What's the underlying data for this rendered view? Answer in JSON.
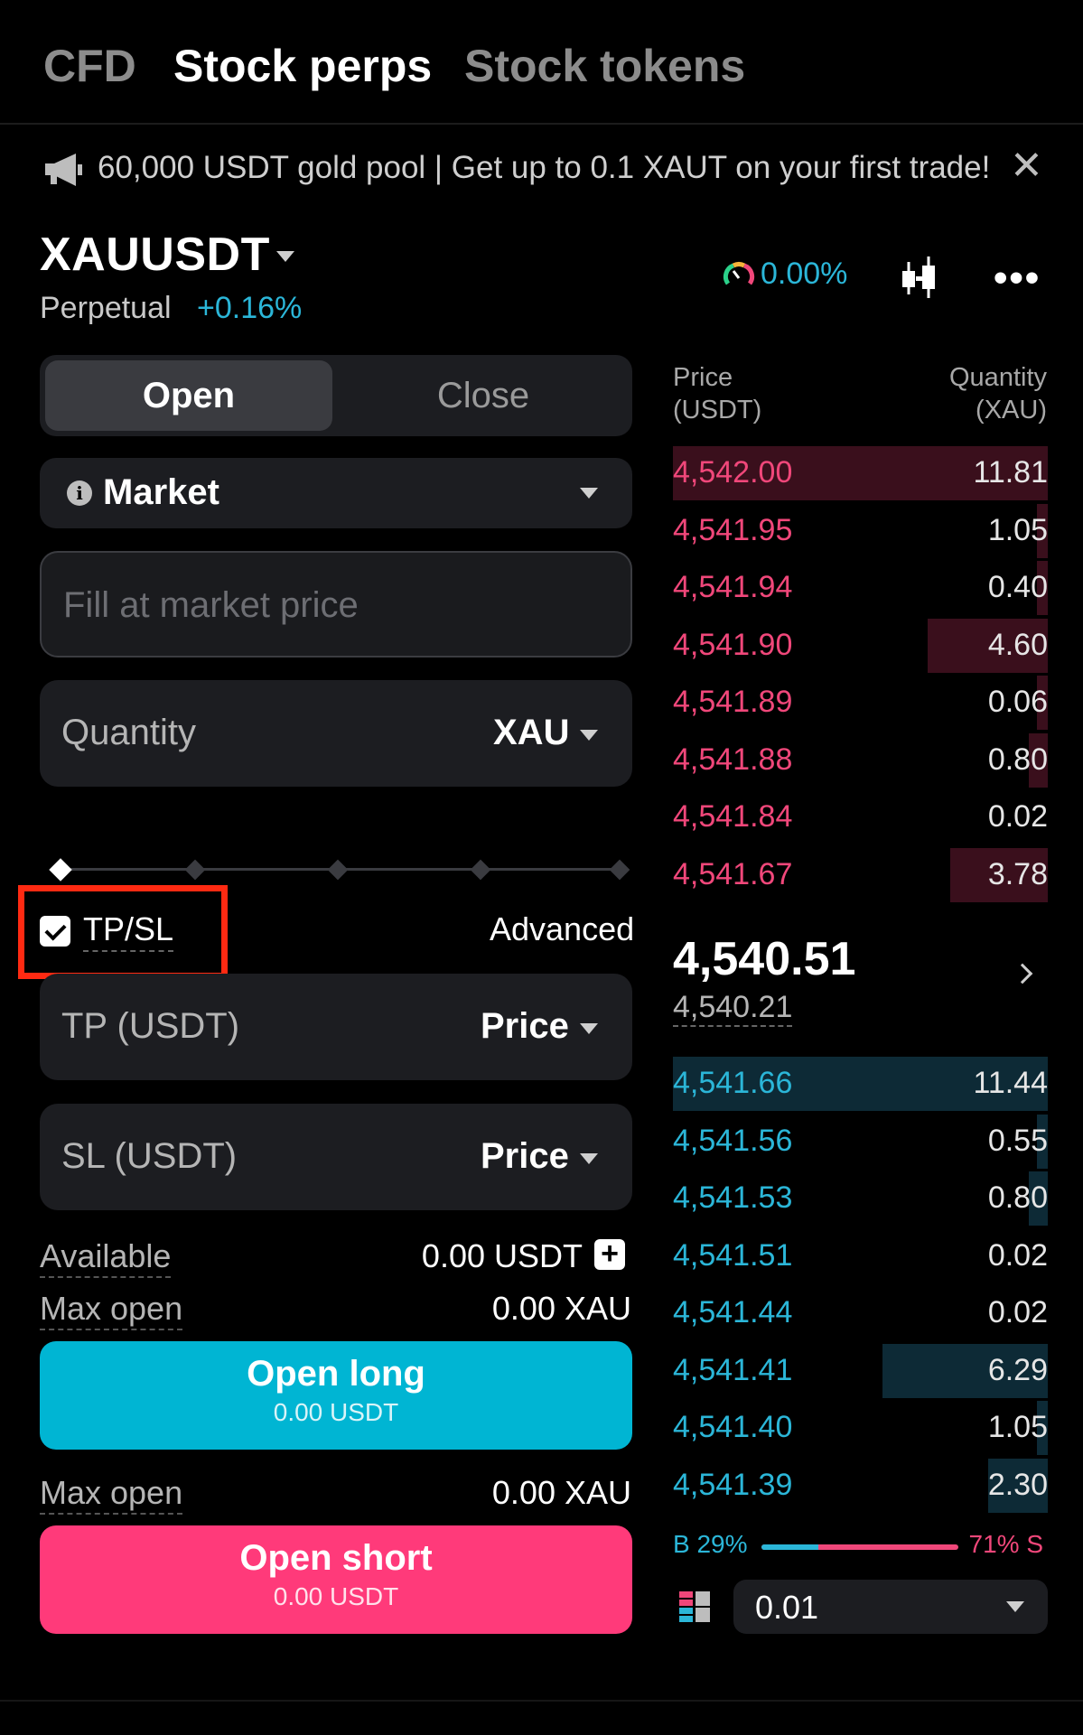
{
  "tabs": [
    {
      "label": "CFD",
      "active": false
    },
    {
      "label": "Stock perps",
      "active": true
    },
    {
      "label": "Stock tokens",
      "active": false
    }
  ],
  "banner": {
    "text": "60,000 USDT gold pool | Get up to 0.1 XAUT on your first trade!",
    "close": "✕"
  },
  "symbol": {
    "name": "XAUUSDT",
    "type": "Perpetual",
    "change": "+0.16%",
    "funding": "0.00%"
  },
  "order_form": {
    "side_toggle": {
      "open": "Open",
      "close": "Close"
    },
    "order_type": "Market",
    "price_placeholder": "Fill at market price",
    "quantity": {
      "label": "Quantity",
      "unit": "XAU"
    },
    "slider_level": 0,
    "tpsl": {
      "label": "TP/SL",
      "checked": true,
      "advanced": "Advanced"
    },
    "tp": {
      "label": "TP (USDT)",
      "mode": "Price"
    },
    "sl": {
      "label": "SL (USDT)",
      "mode": "Price"
    },
    "available": {
      "label": "Available",
      "value": "0.00 USDT"
    },
    "max_open_long": {
      "label": "Max open",
      "value": "0.00 XAU"
    },
    "open_long": {
      "label": "Open long",
      "sub": "0.00 USDT"
    },
    "max_open_short": {
      "label": "Max open",
      "value": "0.00 XAU"
    },
    "open_short": {
      "label": "Open short",
      "sub": "0.00 USDT"
    }
  },
  "orderbook": {
    "price_header": "Price",
    "price_unit": "(USDT)",
    "qty_header": "Quantity",
    "qty_unit": "(XAU)",
    "asks": [
      {
        "price": "4,542.00",
        "qty": "11.81",
        "depth": 1.0
      },
      {
        "price": "4,541.95",
        "qty": "1.05",
        "depth": 0.03
      },
      {
        "price": "4,541.94",
        "qty": "0.40",
        "depth": 0.03
      },
      {
        "price": "4,541.90",
        "qty": "4.60",
        "depth": 0.32
      },
      {
        "price": "4,541.89",
        "qty": "0.06",
        "depth": 0.03
      },
      {
        "price": "4,541.88",
        "qty": "0.80",
        "depth": 0.05
      },
      {
        "price": "4,541.84",
        "qty": "0.02",
        "depth": 0.0
      },
      {
        "price": "4,541.67",
        "qty": "3.78",
        "depth": 0.26
      }
    ],
    "last_price": "4,540.51",
    "mark_price": "4,540.21",
    "bids": [
      {
        "price": "4,541.66",
        "qty": "11.44",
        "depth": 1.0
      },
      {
        "price": "4,541.56",
        "qty": "0.55",
        "depth": 0.03
      },
      {
        "price": "4,541.53",
        "qty": "0.80",
        "depth": 0.05
      },
      {
        "price": "4,541.51",
        "qty": "0.02",
        "depth": 0.0
      },
      {
        "price": "4,541.44",
        "qty": "0.02",
        "depth": 0.0
      },
      {
        "price": "4,541.41",
        "qty": "6.29",
        "depth": 0.44
      },
      {
        "price": "4,541.40",
        "qty": "1.05",
        "depth": 0.03
      },
      {
        "price": "4,541.39",
        "qty": "2.30",
        "depth": 0.16
      }
    ],
    "buy_ratio": "B 29%",
    "sell_ratio": "71% S",
    "buy_fraction": 0.29,
    "precision": "0.01"
  },
  "colors": {
    "accent_long": "#00b5d3",
    "accent_short": "#ff3a7a",
    "ask_text": "#f0477a",
    "bid_text": "#2bb6d8",
    "highlight": "#ff2a12"
  },
  "icons": [
    "megaphone-icon",
    "close-icon",
    "gauge-icon",
    "candlestick-icon",
    "more-icon",
    "info-icon",
    "chevron-down-icon",
    "check-icon",
    "plus-icon",
    "chevron-right-icon",
    "layout-icon"
  ]
}
